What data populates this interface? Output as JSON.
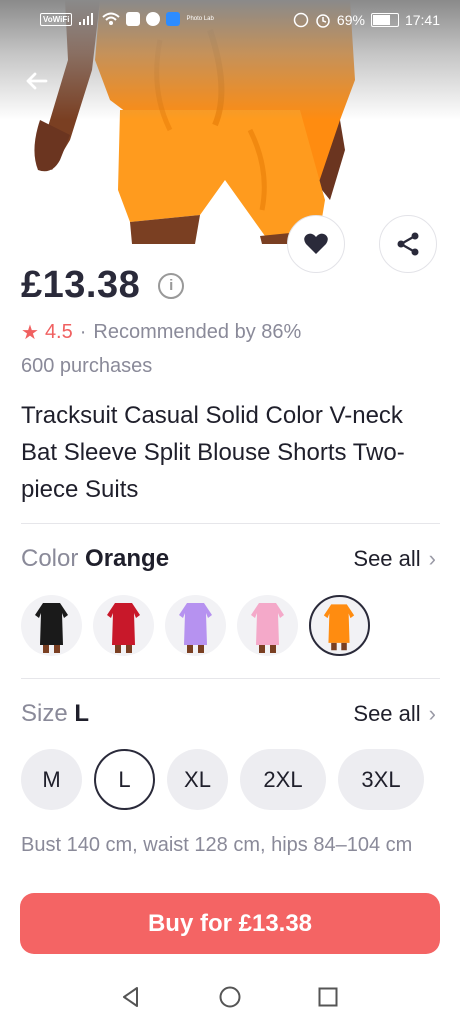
{
  "status_bar": {
    "vowifi": "VoWiFi",
    "app_label": "Photo Lab",
    "battery": "69%",
    "time": "17:41"
  },
  "product": {
    "price": "£13.38",
    "rating": "4.5",
    "recommended": "Recommended by 86%",
    "purchases": "600 purchases",
    "title": "Tracksuit Casual Solid Color V-neck Bat Sleeve Split Blouse Shorts Two-piece Suits"
  },
  "color_section": {
    "label": "Color",
    "selected": "Orange",
    "see_all": "See all",
    "swatches": [
      {
        "name": "black",
        "color": "#1a1a1a"
      },
      {
        "name": "red",
        "color": "#c8182a"
      },
      {
        "name": "lavender",
        "color": "#b692f0"
      },
      {
        "name": "pink",
        "color": "#f4a9c9"
      },
      {
        "name": "orange",
        "color": "#ff8c10"
      }
    ]
  },
  "size_section": {
    "label": "Size",
    "selected": "L",
    "see_all": "See all",
    "options": [
      "M",
      "L",
      "XL",
      "2XL",
      "3XL"
    ]
  },
  "measurements": "Bust 140 cm, waist 128 cm, hips 84–104 cm",
  "buy_button": "Buy for £13.38",
  "colors": {
    "accent": "#f46464",
    "rating_star": "#f06060",
    "product_orange": "#ff8c10"
  }
}
